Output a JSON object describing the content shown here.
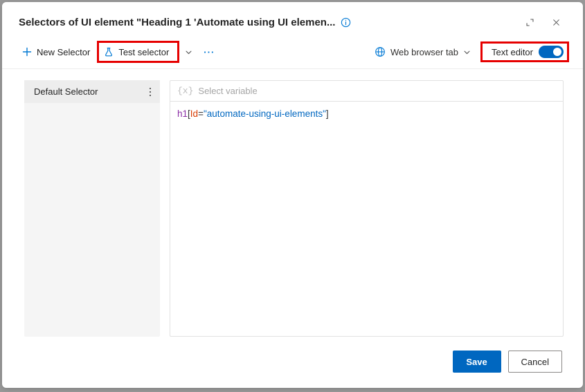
{
  "title": "Selectors of UI element \"Heading 1 'Automate using UI elemen...",
  "toolbar": {
    "new_selector_label": "New Selector",
    "test_selector_label": "Test selector",
    "browser_tab_label": "Web browser tab",
    "text_editor_label": "Text editor",
    "text_editor_on": true
  },
  "sidebar": {
    "items": [
      {
        "label": "Default Selector"
      }
    ]
  },
  "editor": {
    "variable_placeholder": "Select variable",
    "code": {
      "tag": "h1",
      "attr": "Id",
      "value": "automate-using-ui-elements"
    }
  },
  "footer": {
    "save_label": "Save",
    "cancel_label": "Cancel"
  },
  "highlights": {
    "color": "#e60000"
  }
}
